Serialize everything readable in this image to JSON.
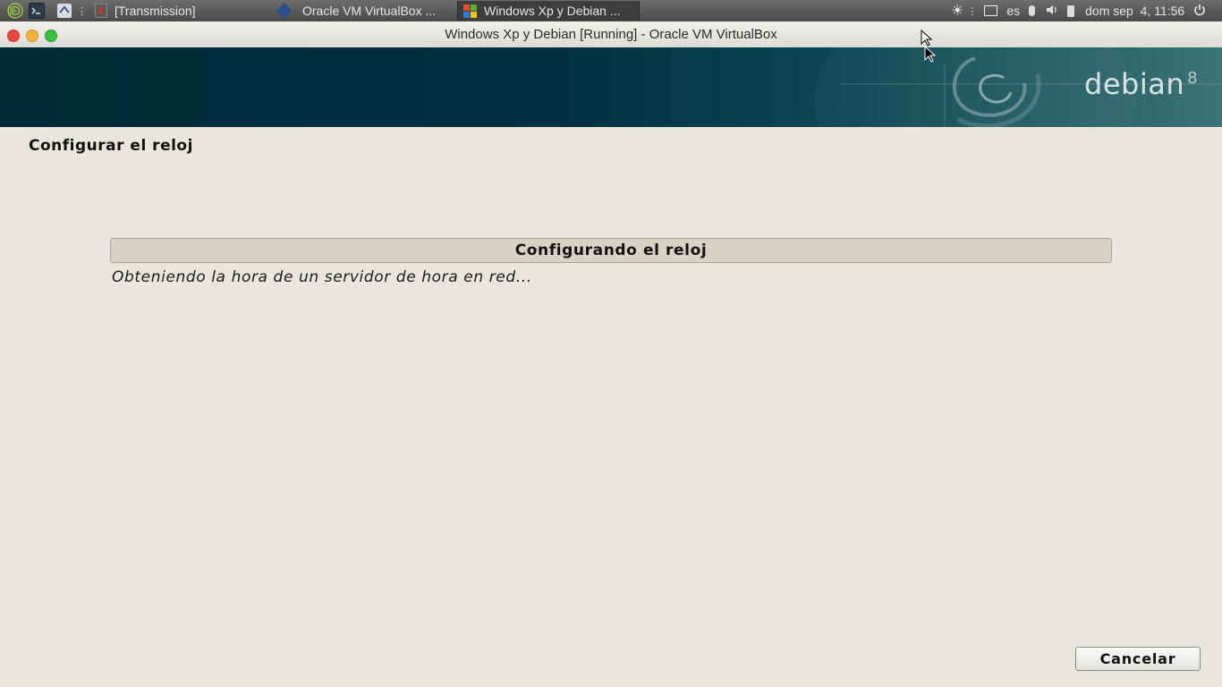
{
  "panel": {
    "tasks": [
      {
        "label": "[Transmission]",
        "icon": "transmission-icon"
      },
      {
        "label": "Oracle VM VirtualBox ...",
        "icon": "virtualbox-icon"
      },
      {
        "label": "Windows Xp y Debian ...",
        "icon": "windows-xp-icon",
        "active": true
      }
    ],
    "tray": {
      "language": "es",
      "clock": "dom sep  4, 11:56"
    }
  },
  "window": {
    "title": "Windows Xp y Debian [Running] - Oracle VM VirtualBox"
  },
  "banner": {
    "brand": "debian",
    "version": "8"
  },
  "installer": {
    "section_title": "Configurar el reloj",
    "progress_title": "Configurando el reloj",
    "progress_fraction": 0,
    "status_text": "Obteniendo la hora de un servidor de hora en red...",
    "cancel_label": "Cancelar"
  },
  "colors": {
    "banner_dark": "#002a38",
    "background": "#e8e6df",
    "close": "#e9463d",
    "minimize": "#f0b43a",
    "maximize": "#37c23f"
  }
}
